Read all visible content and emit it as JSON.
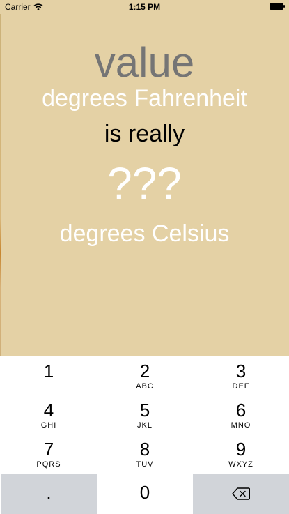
{
  "status_bar": {
    "carrier": "Carrier",
    "time": "1:15 PM",
    "icons": [
      "wifi-icon",
      "battery-icon"
    ]
  },
  "converter": {
    "value_placeholder": "value",
    "fahrenheit_label": "degrees Fahrenheit",
    "is_really_label": "is really",
    "result_value": "???",
    "celsius_label": "degrees Celsius"
  },
  "colors": {
    "background": "#e4d1a5",
    "placeholder": "#a39882",
    "label_white": "#ffffff",
    "keypad_gray": "#d1d4d9"
  },
  "keypad": {
    "keys": [
      {
        "num": "1",
        "letters": ""
      },
      {
        "num": "2",
        "letters": "ABC"
      },
      {
        "num": "3",
        "letters": "DEF"
      },
      {
        "num": "4",
        "letters": "GHI"
      },
      {
        "num": "5",
        "letters": "JKL"
      },
      {
        "num": "6",
        "letters": "MNO"
      },
      {
        "num": "7",
        "letters": "PQRS"
      },
      {
        "num": "8",
        "letters": "TUV"
      },
      {
        "num": "9",
        "letters": "WXYZ"
      }
    ],
    "decimal": ".",
    "zero": "0",
    "delete_icon": "delete-backspace-icon"
  }
}
